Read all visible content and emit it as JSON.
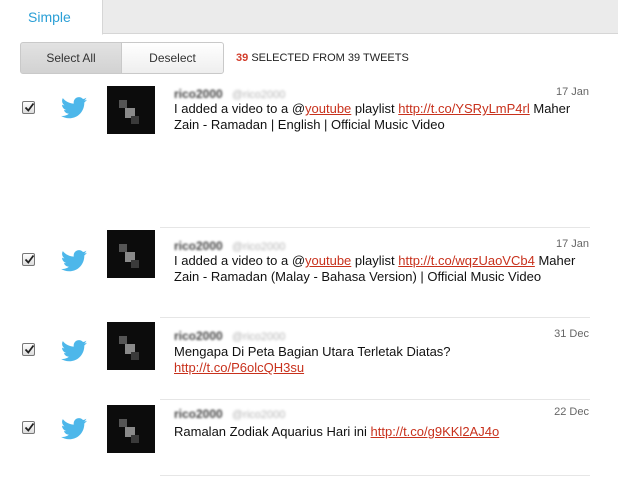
{
  "tabs": {
    "simple": "Simple"
  },
  "toolbar": {
    "select_all": "Select All",
    "deselect": "Deselect"
  },
  "summary": {
    "count": "39",
    "text": "SELECTED FROM 39 TWEETS"
  },
  "tweets": [
    {
      "checked": true,
      "name": "rico2000",
      "handle": "@rico2000",
      "date": "17 Jan",
      "pre": "I added a video to a @",
      "mention": "youtube",
      "mid": " playlist ",
      "link": "http://t.co/YSRyLmP4rl",
      "post": " Maher Zain - Ramadan | English | Official Music Video"
    },
    {
      "checked": true,
      "name": "rico2000",
      "handle": "@rico2000",
      "date": "17 Jan",
      "pre": "I added a video to a @",
      "mention": "youtube",
      "mid": " playlist ",
      "link": "http://t.co/wqzUaoVCb4",
      "post": " Maher Zain - Ramadan (Malay - Bahasa Version) | Official Music Video"
    },
    {
      "checked": true,
      "name": "rico2000",
      "handle": "@rico2000",
      "date": "31 Dec",
      "pre": "Mengapa Di Peta Bagian Utara Terletak Diatas? ",
      "link": "http://t.co/P6olcQH3su"
    },
    {
      "checked": true,
      "name": "rico2000",
      "handle": "@rico2000",
      "date": "22 Dec",
      "pre": "Ramalan Zodiak Aquarius Hari ini ",
      "link": "http://t.co/g9KKl2AJ4o"
    }
  ],
  "colors": {
    "accent": "#2a9fd6",
    "link": "#c8311c",
    "count": "#d23c2a"
  },
  "icons": {
    "service": "twitter-bird-icon"
  }
}
